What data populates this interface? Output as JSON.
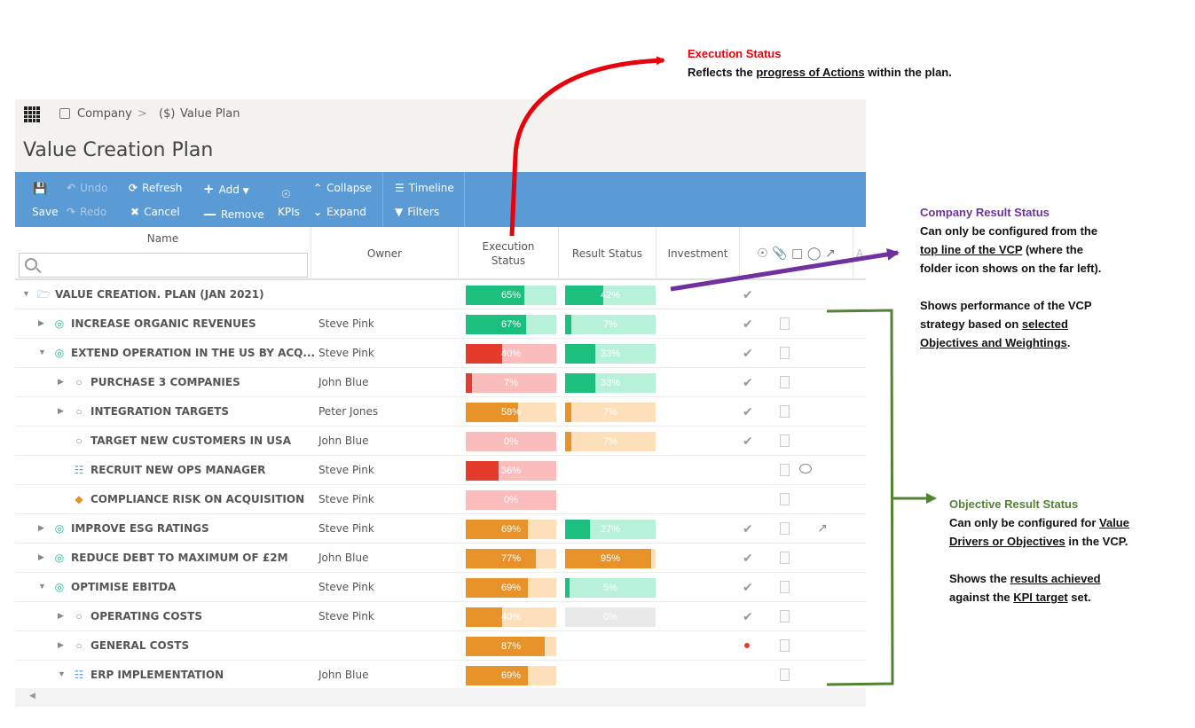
{
  "breadcrumb": {
    "company": "Company",
    "sep": ">",
    "plan": "Value Plan"
  },
  "page_title": "Value Creation Plan",
  "toolbar": {
    "save": "Save",
    "undo": "Undo",
    "redo": "Redo",
    "refresh": "Refresh",
    "cancel": "Cancel",
    "add": "Add",
    "remove": "Remove",
    "kpis": "KPIs",
    "collapse": "Collapse",
    "expand": "Expand",
    "timeline": "Timeline",
    "filters": "Filters"
  },
  "columns": {
    "name": "Name",
    "owner": "Owner",
    "execution_status": "Execution Status",
    "result_status": "Result Status",
    "investment": "Investment"
  },
  "rows": [
    {
      "name": "VALUE CREATION. PLAN (JAN 2021)",
      "owner": "",
      "exec": 65,
      "exec_label": "65%",
      "result": 42,
      "result_label": "42%"
    },
    {
      "name": "INCREASE ORGANIC REVENUES",
      "owner": "Steve Pink",
      "exec": 67,
      "exec_label": "67%",
      "result": 7,
      "result_label": "7%"
    },
    {
      "name": "EXTEND OPERATION IN THE US BY ACQ...",
      "owner": "Steve Pink",
      "exec": 40,
      "exec_label": "40%",
      "result": 33,
      "result_label": "33%"
    },
    {
      "name": "PURCHASE 3 COMPANIES",
      "owner": "John Blue",
      "exec": 7,
      "exec_label": "7%",
      "result": 33,
      "result_label": "33%"
    },
    {
      "name": "INTEGRATION TARGETS",
      "owner": "Peter Jones",
      "exec": 58,
      "exec_label": "58%",
      "result": 7,
      "result_label": "7%"
    },
    {
      "name": "TARGET NEW CUSTOMERS IN USA",
      "owner": "John Blue",
      "exec": 0,
      "exec_label": "0%",
      "result": 7,
      "result_label": "7%"
    },
    {
      "name": "RECRUIT NEW OPS MANAGER",
      "owner": "Steve Pink",
      "exec": 36,
      "exec_label": "36%"
    },
    {
      "name": "COMPLIANCE RISK ON ACQUISITION",
      "owner": "Steve Pink",
      "exec": 0,
      "exec_label": "0%"
    },
    {
      "name": "IMPROVE ESG RATINGS",
      "owner": "Steve Pink",
      "exec": 69,
      "exec_label": "69%",
      "result": 27,
      "result_label": "27%"
    },
    {
      "name": "REDUCE DEBT TO MAXIMUM OF £2M",
      "owner": "John Blue",
      "exec": 77,
      "exec_label": "77%",
      "result": 95,
      "result_label": "95%"
    },
    {
      "name": "OPTIMISE EBITDA",
      "owner": "Steve Pink",
      "exec": 69,
      "exec_label": "69%",
      "result": 5,
      "result_label": "5%"
    },
    {
      "name": "OPERATING COSTS",
      "owner": "Steve Pink",
      "exec": 40,
      "exec_label": "40%",
      "result": 0,
      "result_label": "0%"
    },
    {
      "name": "GENERAL COSTS",
      "owner": "",
      "exec": 87,
      "exec_label": "87%"
    },
    {
      "name": "ERP IMPLEMENTATION",
      "owner": "John Blue",
      "exec": 69,
      "exec_label": "69%"
    }
  ],
  "annotations": {
    "exec": {
      "title": "Execution Status",
      "line1_a": "Reflects the ",
      "line1_u": "progress of Actions",
      "line1_b": " within the plan."
    },
    "company": {
      "title": "Company Result Status",
      "l1": "Can only be configured from the",
      "l2_u": "top line of the VCP",
      "l2_b": " (where the",
      "l3": "folder icon shows on the far left).",
      "l4": "Shows performance of the VCP",
      "l5_a": "strategy based on ",
      "l5_u": "selected",
      "l6_u": "Objectives and Weightings",
      "l6_b": "."
    },
    "objective": {
      "title": "Objective Result Status",
      "l1_a": "Can only be configured for ",
      "l1_u": "Value",
      "l2_u": "Drivers or Objectives",
      "l2_b": " in the VCP.",
      "l3_a": "Shows the ",
      "l3_u": "results achieved",
      "l4_a": "against the ",
      "l4_u": "KPI target",
      "l4_b": " set."
    }
  },
  "colors": {
    "green": "#1bbf7e",
    "green_light": "#b7f1da",
    "red": "#e53b2c",
    "red_light": "#fbbcbc",
    "orange": "#e8922a",
    "orange_light": "#fde0b9",
    "grey_light": "#e9e9e9",
    "toolbar_blue": "#5b9bd5"
  }
}
